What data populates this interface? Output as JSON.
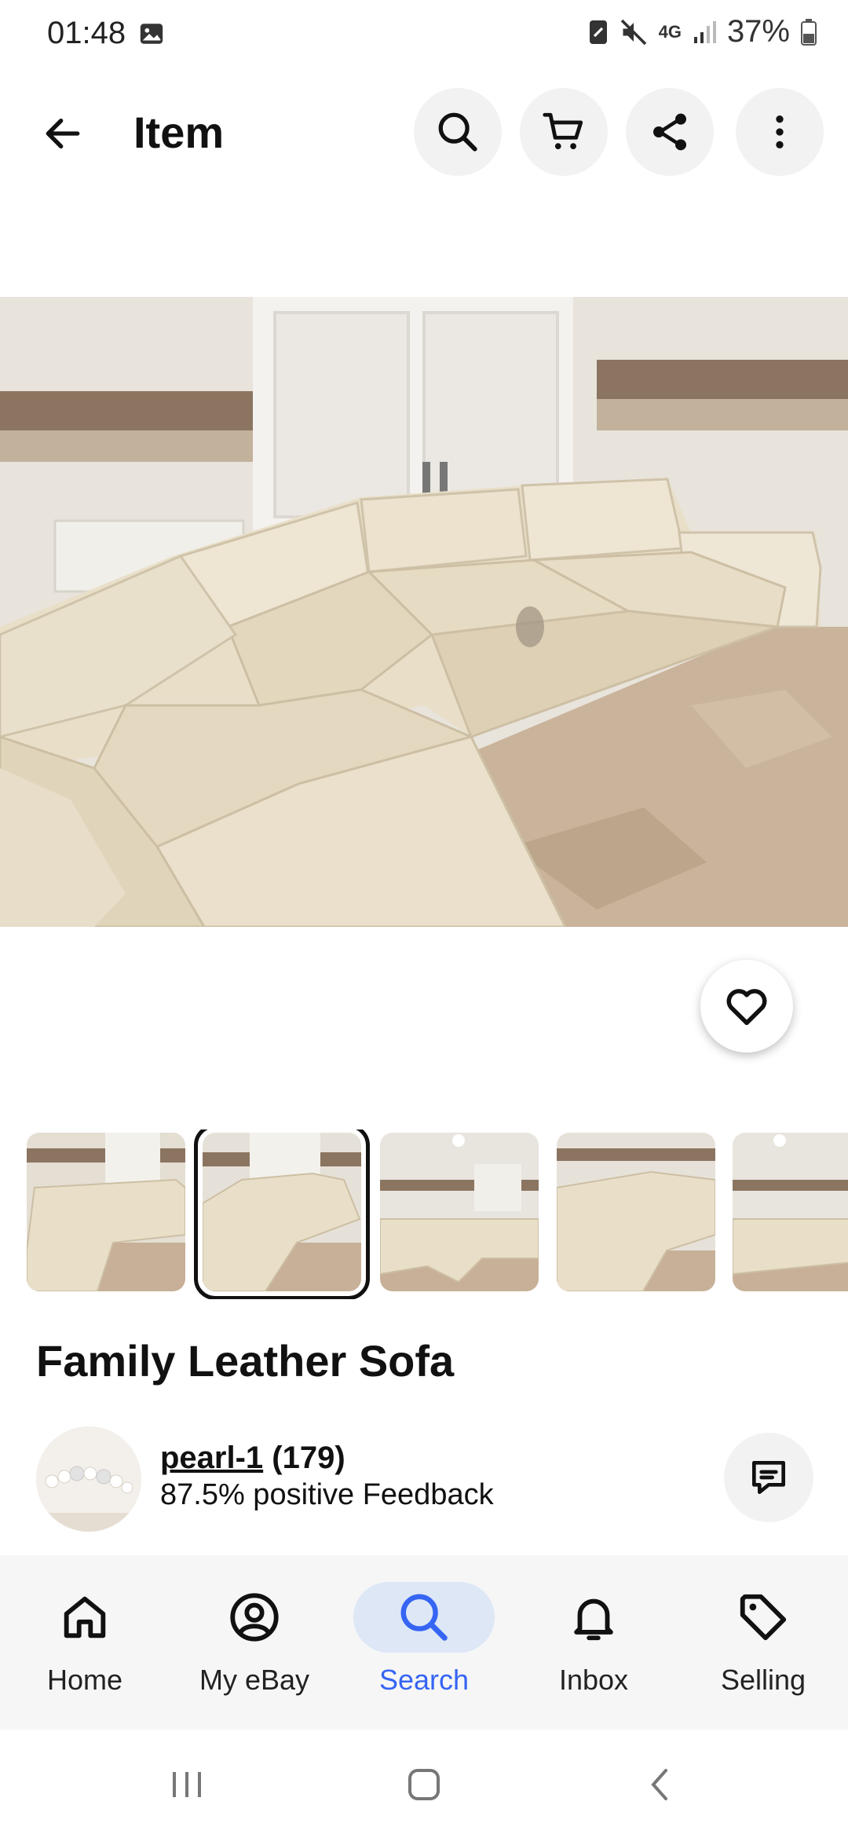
{
  "status": {
    "time": "01:48",
    "network": "4G",
    "battery": "37%"
  },
  "appbar": {
    "title": "Item",
    "icons": [
      "back-arrow-icon",
      "search-icon",
      "cart-icon",
      "share-icon",
      "more-vertical-icon"
    ]
  },
  "item": {
    "title": "Family Leather Sofa",
    "thumbnail_count": 5,
    "selected_thumbnail": 2
  },
  "seller": {
    "name": "pearl-1",
    "count": "(179)",
    "feedback": "87.5% positive Feedback"
  },
  "bottom_nav": {
    "home": "Home",
    "myebay": "My eBay",
    "search": "Search",
    "inbox": "Inbox",
    "selling": "Selling",
    "active": "Search"
  },
  "colors": {
    "accent": "#3665f3",
    "active_pill": "#dde7f6",
    "nav_bg": "#f6f6f6"
  }
}
